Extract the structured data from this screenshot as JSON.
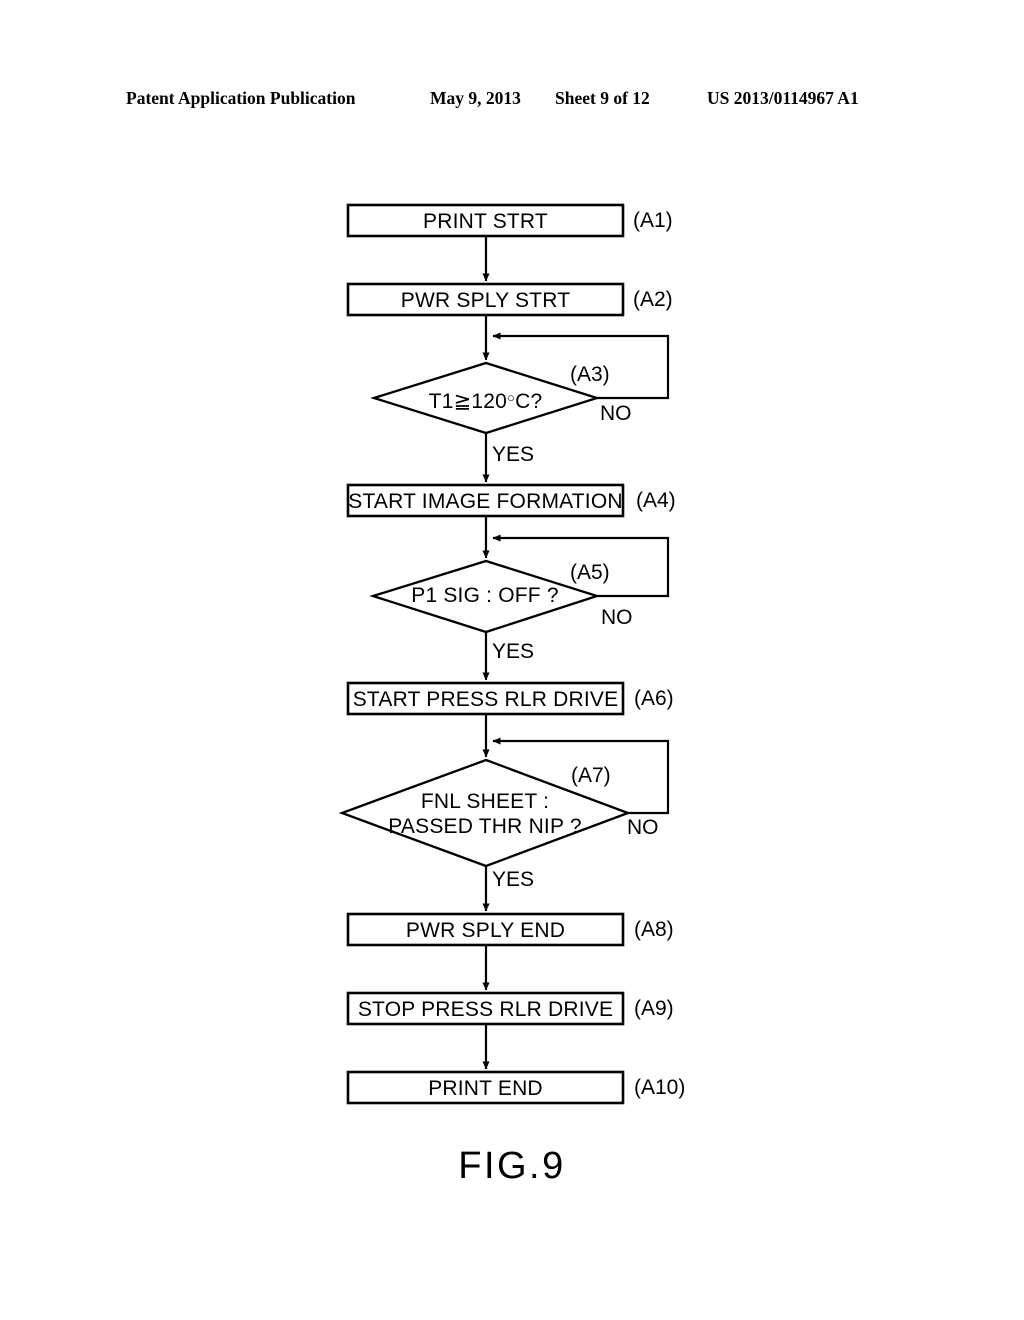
{
  "header": {
    "publication": "Patent Application Publication",
    "date": "May 9, 2013",
    "sheet": "Sheet 9 of 12",
    "patent_number": "US 2013/0114967 A1"
  },
  "figure": {
    "caption": "FIG.9"
  },
  "chart_data": {
    "type": "flowchart",
    "title": "FIG.9",
    "orientation": "top-to-bottom",
    "nodes": [
      {
        "id": "A1",
        "ref": "(A1)",
        "shape": "process",
        "text": "PRINT STRT"
      },
      {
        "id": "A2",
        "ref": "(A2)",
        "shape": "process",
        "text": "PWR SPLY STRT"
      },
      {
        "id": "A3",
        "ref": "(A3)",
        "shape": "decision",
        "text": "T1≧120°C?",
        "text_prefix": "T1≧120",
        "text_suffix": "C?"
      },
      {
        "id": "A4",
        "ref": "(A4)",
        "shape": "process",
        "text": "START IMAGE FORMATION"
      },
      {
        "id": "A5",
        "ref": "(A5)",
        "shape": "decision",
        "text": "P1 SIG : OFF ?"
      },
      {
        "id": "A6",
        "ref": "(A6)",
        "shape": "process",
        "text": "START PRESS RLR DRIVE"
      },
      {
        "id": "A7",
        "ref": "(A7)",
        "shape": "decision",
        "text_line1": "FNL SHEET :",
        "text_line2": "PASSED THR NIP ?"
      },
      {
        "id": "A8",
        "ref": "(A8)",
        "shape": "process",
        "text": "PWR SPLY END"
      },
      {
        "id": "A9",
        "ref": "(A9)",
        "shape": "process",
        "text": "STOP PRESS RLR DRIVE"
      },
      {
        "id": "A10",
        "ref": "(A10)",
        "shape": "process",
        "text": "PRINT END"
      }
    ],
    "edges": [
      {
        "from": "A1",
        "to": "A2",
        "label": ""
      },
      {
        "from": "A2",
        "to": "A3",
        "label": ""
      },
      {
        "from": "A3",
        "to": "A4",
        "label": "YES"
      },
      {
        "from": "A3",
        "to": "A3",
        "label": "NO",
        "kind": "loop-back"
      },
      {
        "from": "A4",
        "to": "A5",
        "label": ""
      },
      {
        "from": "A5",
        "to": "A6",
        "label": "YES"
      },
      {
        "from": "A5",
        "to": "A5",
        "label": "NO",
        "kind": "loop-back"
      },
      {
        "from": "A6",
        "to": "A7",
        "label": ""
      },
      {
        "from": "A7",
        "to": "A8",
        "label": "YES"
      },
      {
        "from": "A7",
        "to": "A7",
        "label": "NO",
        "kind": "loop-back"
      },
      {
        "from": "A8",
        "to": "A9",
        "label": ""
      },
      {
        "from": "A9",
        "to": "A10",
        "label": ""
      }
    ],
    "branch_labels": {
      "yes": "YES",
      "no": "NO"
    },
    "colors": {
      "stroke": "#000000",
      "fill": "#ffffff",
      "text": "#000000"
    }
  }
}
